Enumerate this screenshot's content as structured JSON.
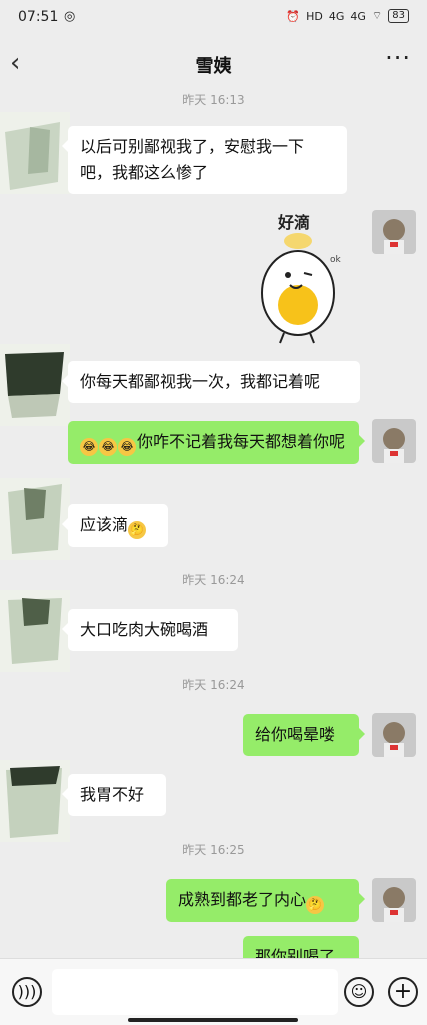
{
  "status_bar": {
    "time": "07:51",
    "left_icon": "signal-circle-icon",
    "hd": "HD",
    "net1": "4G",
    "net2": "4G",
    "battery": "83"
  },
  "header": {
    "title": "雪姨",
    "back_icon": "chevron-left-icon",
    "more_icon": "more-dots-icon"
  },
  "messages": [
    {
      "type": "time",
      "text": "昨天 16:13"
    },
    {
      "type": "in",
      "text": "以后可别鄙视我了，安慰我一下吧，我都这么惨了"
    },
    {
      "type": "sticker",
      "caption": "好滴",
      "sub": "ok"
    },
    {
      "type": "in",
      "text": "你每天都鄙视我一次，我都记着呢"
    },
    {
      "type": "out",
      "emoji_count": 3,
      "text": "你咋不记着我每天都想着你呢"
    },
    {
      "type": "in",
      "text": "应该滴"
    },
    {
      "type": "time",
      "text": "昨天 16:24"
    },
    {
      "type": "in",
      "text": "大口吃肉大碗喝酒"
    },
    {
      "type": "time",
      "text": "昨天 16:24"
    },
    {
      "type": "out",
      "text": "给你喝晕喽"
    },
    {
      "type": "in",
      "text": "我胃不好"
    },
    {
      "type": "time",
      "text": "昨天 16:25"
    },
    {
      "type": "out",
      "text": "成熟到都老了内心"
    },
    {
      "type": "out",
      "text": "那你别喝了"
    }
  ],
  "input_bar": {
    "placeholder": "",
    "voice_icon": "voice-icon",
    "emoji_icon": "emoji-face-icon",
    "plus_icon": "plus-icon"
  },
  "colors": {
    "background": "#ededed",
    "outgoing_bubble": "#95ec69",
    "incoming_bubble": "#ffffff"
  }
}
